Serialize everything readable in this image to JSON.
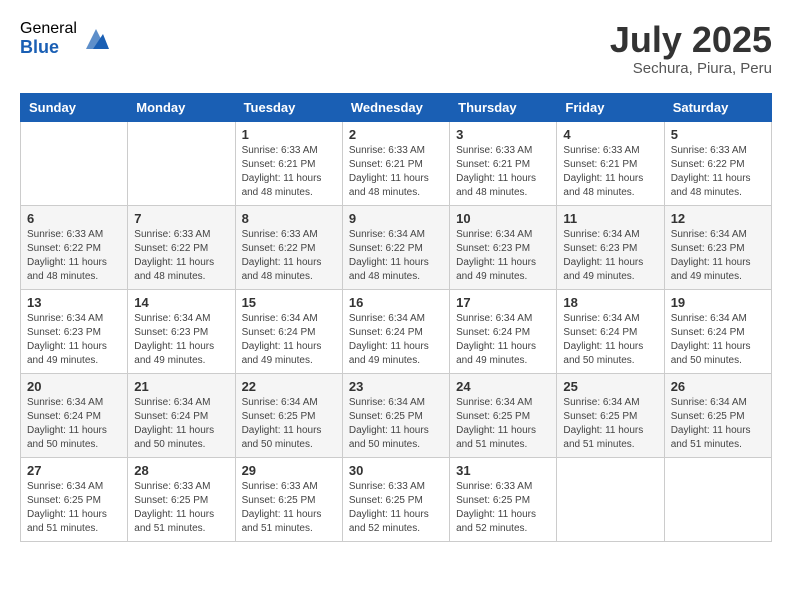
{
  "logo": {
    "general": "General",
    "blue": "Blue"
  },
  "title": {
    "month_year": "July 2025",
    "location": "Sechura, Piura, Peru"
  },
  "weekdays": [
    "Sunday",
    "Monday",
    "Tuesday",
    "Wednesday",
    "Thursday",
    "Friday",
    "Saturday"
  ],
  "weeks": [
    [
      {
        "day": "",
        "info": ""
      },
      {
        "day": "",
        "info": ""
      },
      {
        "day": "1",
        "info": "Sunrise: 6:33 AM\nSunset: 6:21 PM\nDaylight: 11 hours and 48 minutes."
      },
      {
        "day": "2",
        "info": "Sunrise: 6:33 AM\nSunset: 6:21 PM\nDaylight: 11 hours and 48 minutes."
      },
      {
        "day": "3",
        "info": "Sunrise: 6:33 AM\nSunset: 6:21 PM\nDaylight: 11 hours and 48 minutes."
      },
      {
        "day": "4",
        "info": "Sunrise: 6:33 AM\nSunset: 6:21 PM\nDaylight: 11 hours and 48 minutes."
      },
      {
        "day": "5",
        "info": "Sunrise: 6:33 AM\nSunset: 6:22 PM\nDaylight: 11 hours and 48 minutes."
      }
    ],
    [
      {
        "day": "6",
        "info": "Sunrise: 6:33 AM\nSunset: 6:22 PM\nDaylight: 11 hours and 48 minutes."
      },
      {
        "day": "7",
        "info": "Sunrise: 6:33 AM\nSunset: 6:22 PM\nDaylight: 11 hours and 48 minutes."
      },
      {
        "day": "8",
        "info": "Sunrise: 6:33 AM\nSunset: 6:22 PM\nDaylight: 11 hours and 48 minutes."
      },
      {
        "day": "9",
        "info": "Sunrise: 6:34 AM\nSunset: 6:22 PM\nDaylight: 11 hours and 48 minutes."
      },
      {
        "day": "10",
        "info": "Sunrise: 6:34 AM\nSunset: 6:23 PM\nDaylight: 11 hours and 49 minutes."
      },
      {
        "day": "11",
        "info": "Sunrise: 6:34 AM\nSunset: 6:23 PM\nDaylight: 11 hours and 49 minutes."
      },
      {
        "day": "12",
        "info": "Sunrise: 6:34 AM\nSunset: 6:23 PM\nDaylight: 11 hours and 49 minutes."
      }
    ],
    [
      {
        "day": "13",
        "info": "Sunrise: 6:34 AM\nSunset: 6:23 PM\nDaylight: 11 hours and 49 minutes."
      },
      {
        "day": "14",
        "info": "Sunrise: 6:34 AM\nSunset: 6:23 PM\nDaylight: 11 hours and 49 minutes."
      },
      {
        "day": "15",
        "info": "Sunrise: 6:34 AM\nSunset: 6:24 PM\nDaylight: 11 hours and 49 minutes."
      },
      {
        "day": "16",
        "info": "Sunrise: 6:34 AM\nSunset: 6:24 PM\nDaylight: 11 hours and 49 minutes."
      },
      {
        "day": "17",
        "info": "Sunrise: 6:34 AM\nSunset: 6:24 PM\nDaylight: 11 hours and 49 minutes."
      },
      {
        "day": "18",
        "info": "Sunrise: 6:34 AM\nSunset: 6:24 PM\nDaylight: 11 hours and 50 minutes."
      },
      {
        "day": "19",
        "info": "Sunrise: 6:34 AM\nSunset: 6:24 PM\nDaylight: 11 hours and 50 minutes."
      }
    ],
    [
      {
        "day": "20",
        "info": "Sunrise: 6:34 AM\nSunset: 6:24 PM\nDaylight: 11 hours and 50 minutes."
      },
      {
        "day": "21",
        "info": "Sunrise: 6:34 AM\nSunset: 6:24 PM\nDaylight: 11 hours and 50 minutes."
      },
      {
        "day": "22",
        "info": "Sunrise: 6:34 AM\nSunset: 6:25 PM\nDaylight: 11 hours and 50 minutes."
      },
      {
        "day": "23",
        "info": "Sunrise: 6:34 AM\nSunset: 6:25 PM\nDaylight: 11 hours and 50 minutes."
      },
      {
        "day": "24",
        "info": "Sunrise: 6:34 AM\nSunset: 6:25 PM\nDaylight: 11 hours and 51 minutes."
      },
      {
        "day": "25",
        "info": "Sunrise: 6:34 AM\nSunset: 6:25 PM\nDaylight: 11 hours and 51 minutes."
      },
      {
        "day": "26",
        "info": "Sunrise: 6:34 AM\nSunset: 6:25 PM\nDaylight: 11 hours and 51 minutes."
      }
    ],
    [
      {
        "day": "27",
        "info": "Sunrise: 6:34 AM\nSunset: 6:25 PM\nDaylight: 11 hours and 51 minutes."
      },
      {
        "day": "28",
        "info": "Sunrise: 6:33 AM\nSunset: 6:25 PM\nDaylight: 11 hours and 51 minutes."
      },
      {
        "day": "29",
        "info": "Sunrise: 6:33 AM\nSunset: 6:25 PM\nDaylight: 11 hours and 51 minutes."
      },
      {
        "day": "30",
        "info": "Sunrise: 6:33 AM\nSunset: 6:25 PM\nDaylight: 11 hours and 52 minutes."
      },
      {
        "day": "31",
        "info": "Sunrise: 6:33 AM\nSunset: 6:25 PM\nDaylight: 11 hours and 52 minutes."
      },
      {
        "day": "",
        "info": ""
      },
      {
        "day": "",
        "info": ""
      }
    ]
  ]
}
